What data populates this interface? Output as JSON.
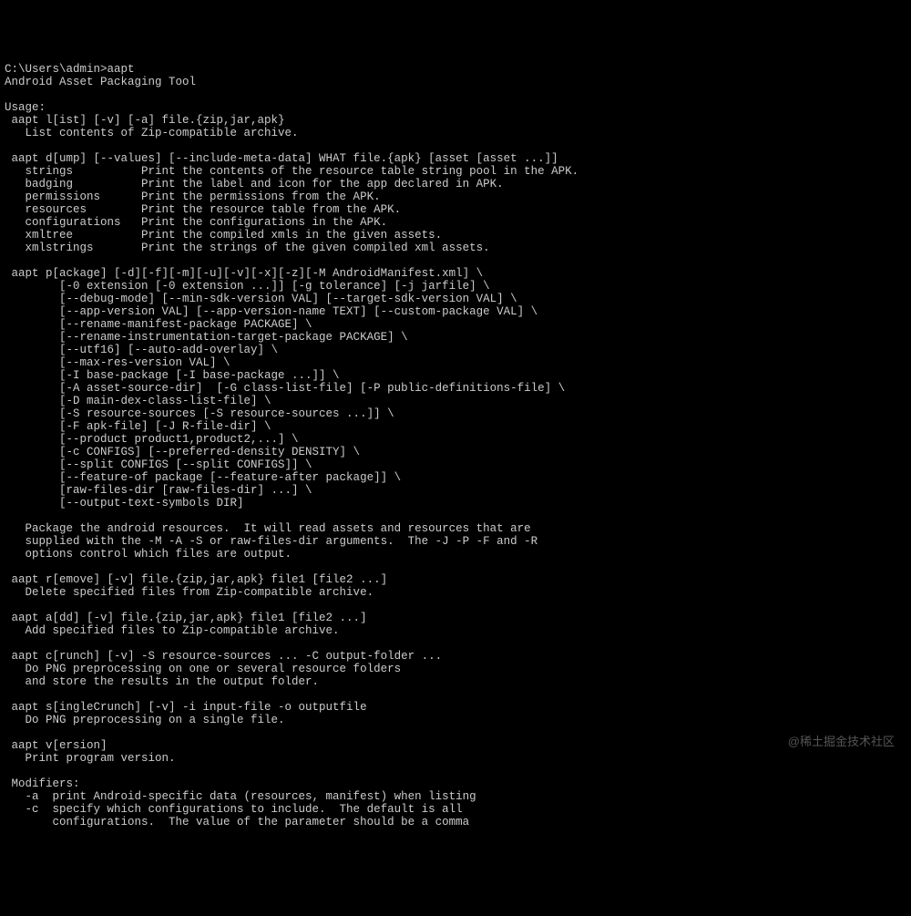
{
  "terminal": {
    "lines": [
      "C:\\Users\\admin>aapt",
      "Android Asset Packaging Tool",
      "",
      "Usage:",
      " aapt l[ist] [-v] [-a] file.{zip,jar,apk}",
      "   List contents of Zip-compatible archive.",
      "",
      " aapt d[ump] [--values] [--include-meta-data] WHAT file.{apk} [asset [asset ...]]",
      "   strings          Print the contents of the resource table string pool in the APK.",
      "   badging          Print the label and icon for the app declared in APK.",
      "   permissions      Print the permissions from the APK.",
      "   resources        Print the resource table from the APK.",
      "   configurations   Print the configurations in the APK.",
      "   xmltree          Print the compiled xmls in the given assets.",
      "   xmlstrings       Print the strings of the given compiled xml assets.",
      "",
      " aapt p[ackage] [-d][-f][-m][-u][-v][-x][-z][-M AndroidManifest.xml] \\",
      "        [-0 extension [-0 extension ...]] [-g tolerance] [-j jarfile] \\",
      "        [--debug-mode] [--min-sdk-version VAL] [--target-sdk-version VAL] \\",
      "        [--app-version VAL] [--app-version-name TEXT] [--custom-package VAL] \\",
      "        [--rename-manifest-package PACKAGE] \\",
      "        [--rename-instrumentation-target-package PACKAGE] \\",
      "        [--utf16] [--auto-add-overlay] \\",
      "        [--max-res-version VAL] \\",
      "        [-I base-package [-I base-package ...]] \\",
      "        [-A asset-source-dir]  [-G class-list-file] [-P public-definitions-file] \\",
      "        [-D main-dex-class-list-file] \\",
      "        [-S resource-sources [-S resource-sources ...]] \\",
      "        [-F apk-file] [-J R-file-dir] \\",
      "        [--product product1,product2,...] \\",
      "        [-c CONFIGS] [--preferred-density DENSITY] \\",
      "        [--split CONFIGS [--split CONFIGS]] \\",
      "        [--feature-of package [--feature-after package]] \\",
      "        [raw-files-dir [raw-files-dir] ...] \\",
      "        [--output-text-symbols DIR]",
      "",
      "   Package the android resources.  It will read assets and resources that are",
      "   supplied with the -M -A -S or raw-files-dir arguments.  The -J -P -F and -R",
      "   options control which files are output.",
      "",
      " aapt r[emove] [-v] file.{zip,jar,apk} file1 [file2 ...]",
      "   Delete specified files from Zip-compatible archive.",
      "",
      " aapt a[dd] [-v] file.{zip,jar,apk} file1 [file2 ...]",
      "   Add specified files to Zip-compatible archive.",
      "",
      " aapt c[runch] [-v] -S resource-sources ... -C output-folder ...",
      "   Do PNG preprocessing on one or several resource folders",
      "   and store the results in the output folder.",
      "",
      " aapt s[ingleCrunch] [-v] -i input-file -o outputfile",
      "   Do PNG preprocessing on a single file.",
      "",
      " aapt v[ersion]",
      "   Print program version.",
      "",
      " Modifiers:",
      "   -a  print Android-specific data (resources, manifest) when listing",
      "   -c  specify which configurations to include.  The default is all",
      "       configurations.  The value of the parameter should be a comma"
    ]
  },
  "watermark": "@稀土掘金技术社区"
}
